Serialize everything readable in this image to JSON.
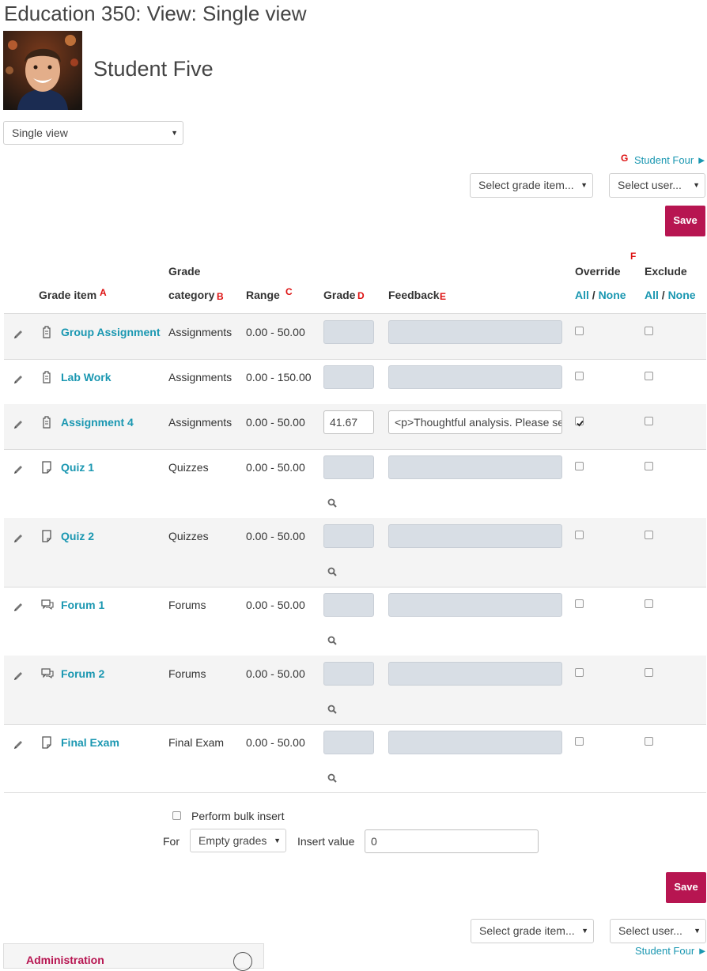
{
  "page": {
    "title": "Education 350: View: Single view",
    "student_name": "Student Five"
  },
  "view_select": {
    "value": "Single view"
  },
  "nav": {
    "next_user_label": "Student Four ►",
    "grade_item_select": "Select grade item...",
    "user_select": "Select user..."
  },
  "save_label": "Save",
  "markers": {
    "a": "A",
    "b": "B",
    "c": "C",
    "d": "D",
    "e": "E",
    "f": "F",
    "g": "G"
  },
  "table": {
    "headers": {
      "grade_item": "Grade item",
      "grade_category_1": "Grade",
      "grade_category_2": "category",
      "range": "Range",
      "grade": "Grade",
      "feedback": "Feedback",
      "override": "Override",
      "exclude": "Exclude",
      "all": "All",
      "sep": " / ",
      "none": "None"
    },
    "rows": [
      {
        "name": "Group Assignment",
        "category": "Assignments",
        "range": "0.00 - 50.00",
        "grade": "",
        "feedback": "",
        "override": false,
        "exclude": false,
        "icon": "assignment-icon"
      },
      {
        "name": "Lab Work",
        "category": "Assignments",
        "range": "0.00 - 150.00",
        "grade": "",
        "feedback": "",
        "override": false,
        "exclude": false,
        "icon": "assignment-icon"
      },
      {
        "name": "Assignment 4",
        "category": "Assignments",
        "range": "0.00 - 50.00",
        "grade": "41.67",
        "feedback": "<p>Thoughtful analysis. Please se",
        "override": true,
        "exclude": false,
        "icon": "assignment-icon"
      },
      {
        "name": "Quiz 1",
        "category": "Quizzes",
        "range": "0.00 - 50.00",
        "grade": "",
        "feedback": "",
        "override": false,
        "exclude": false,
        "icon": "quiz-icon"
      },
      {
        "name": "Quiz 2",
        "category": "Quizzes",
        "range": "0.00 - 50.00",
        "grade": "",
        "feedback": "",
        "override": false,
        "exclude": false,
        "icon": "quiz-icon"
      },
      {
        "name": "Forum 1",
        "category": "Forums",
        "range": "0.00 - 50.00",
        "grade": "",
        "feedback": "",
        "override": false,
        "exclude": false,
        "icon": "forum-icon"
      },
      {
        "name": "Forum 2",
        "category": "Forums",
        "range": "0.00 - 50.00",
        "grade": "",
        "feedback": "",
        "override": false,
        "exclude": false,
        "icon": "forum-icon"
      },
      {
        "name": "Final Exam",
        "category": "Final Exam",
        "range": "0.00 - 50.00",
        "grade": "",
        "feedback": "",
        "override": false,
        "exclude": false,
        "icon": "quiz-icon"
      }
    ]
  },
  "bulk": {
    "label": "Perform bulk insert",
    "for_label": "For",
    "for_value": "Empty grades",
    "insert_label": "Insert value",
    "insert_value": "0"
  },
  "admin": {
    "title": "Administration"
  }
}
